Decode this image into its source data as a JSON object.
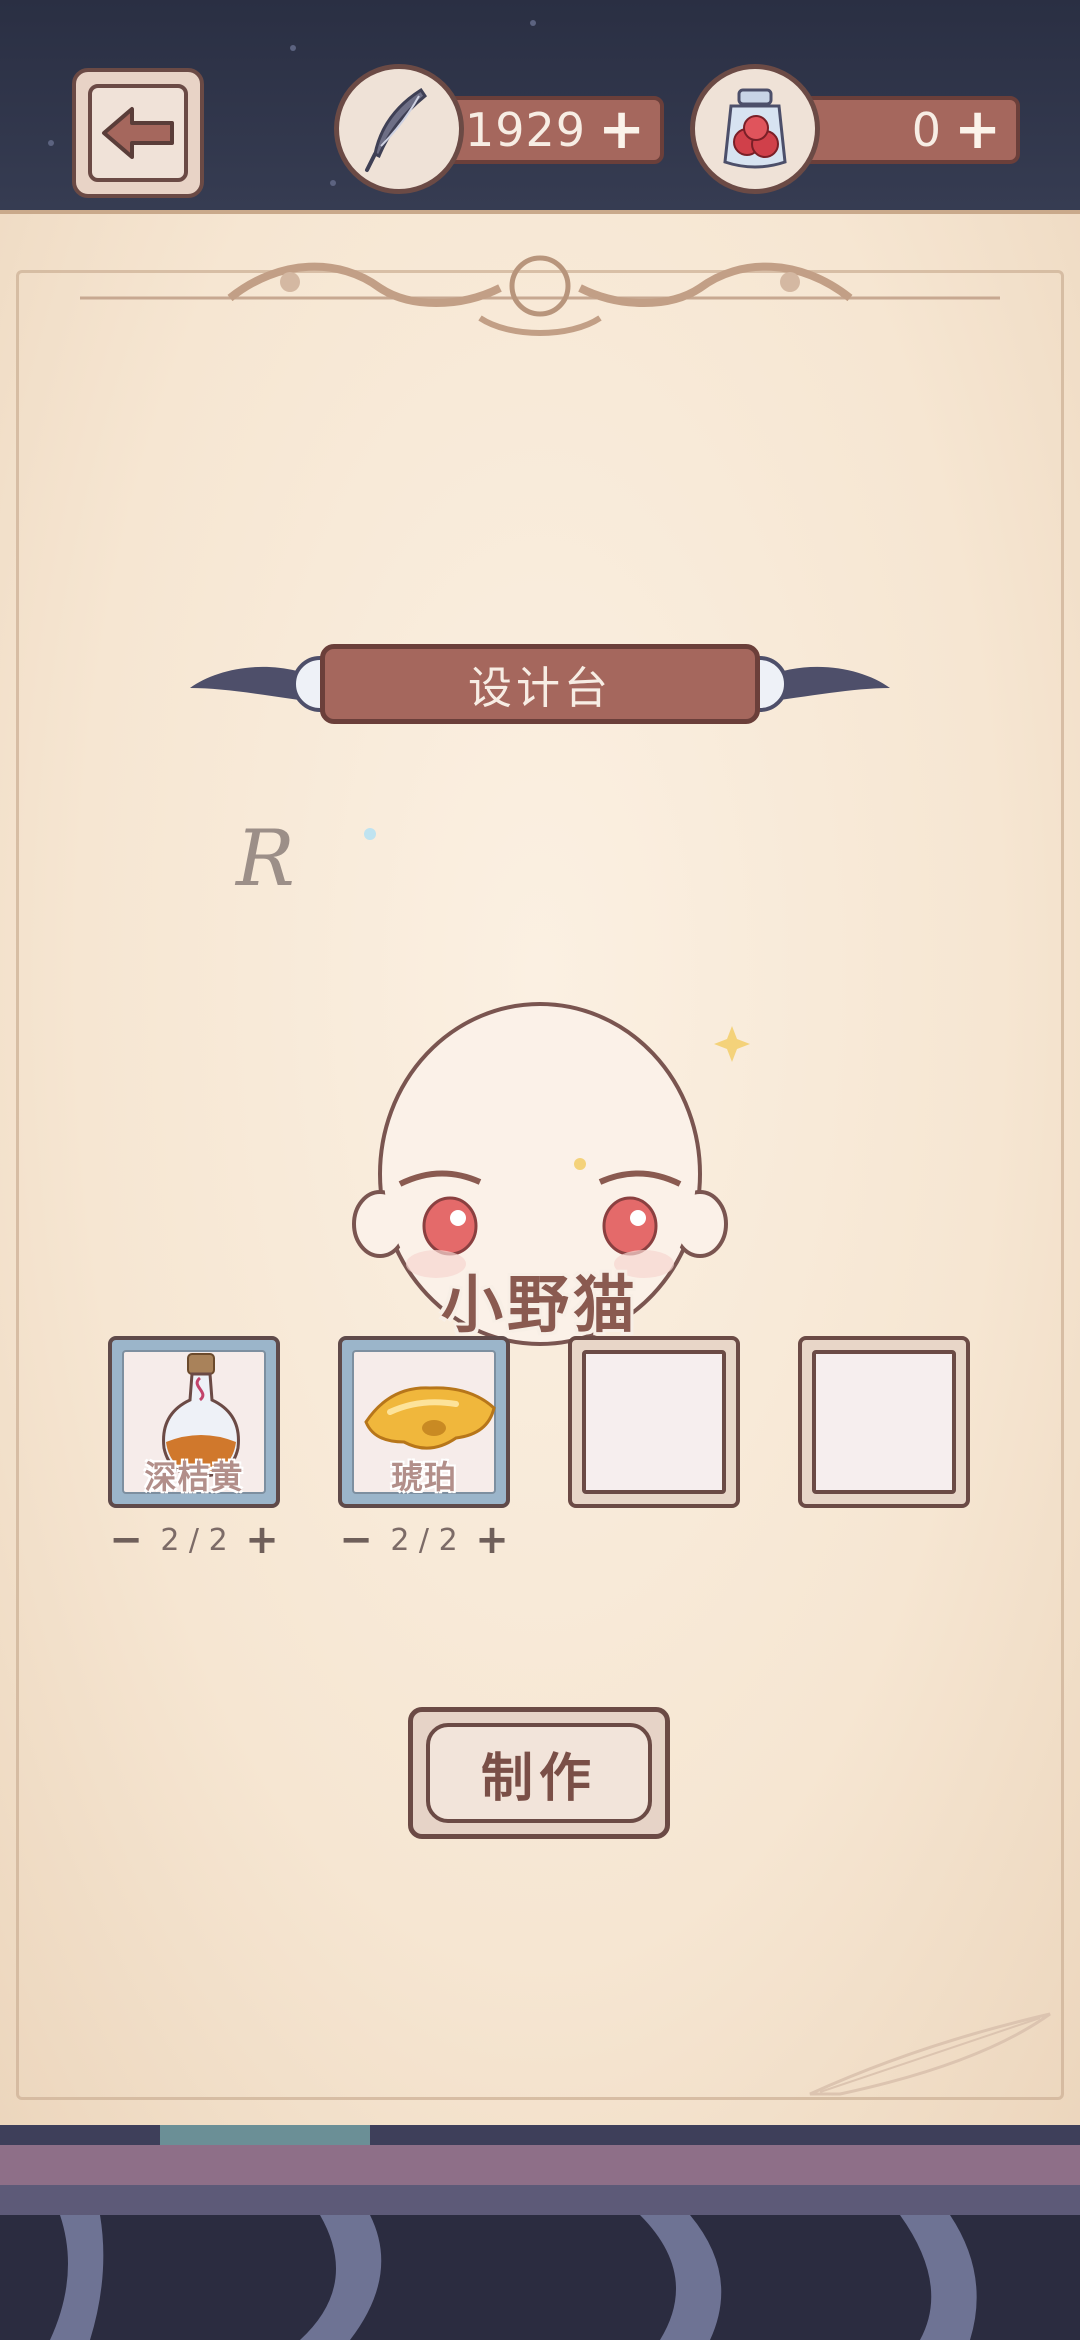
{
  "header": {
    "back_icon": "left-arrow-icon",
    "currencies": [
      {
        "icon": "feather-quill-icon",
        "value": "1929",
        "plus": "+"
      },
      {
        "icon": "berry-jar-icon",
        "value": "0",
        "plus": "+"
      }
    ]
  },
  "panel": {
    "title": "设计台",
    "rarity": "R",
    "item_name": "小野猫"
  },
  "materials": [
    {
      "name": "深桔黄",
      "icon": "orange-potion-bottle-icon",
      "count": "2 / 2",
      "minus": "−",
      "plus": "+"
    },
    {
      "name": "琥珀",
      "icon": "amber-stone-icon",
      "count": "2 / 2",
      "minus": "−",
      "plus": "+"
    },
    {
      "name": "",
      "icon": "empty-slot"
    },
    {
      "name": "",
      "icon": "empty-slot"
    }
  ],
  "make_button": {
    "label": "制作"
  },
  "colors": {
    "accent": "#a5675d",
    "outline": "#6b4a45",
    "paper": "#f6e6d2",
    "night": "#2f3447"
  }
}
